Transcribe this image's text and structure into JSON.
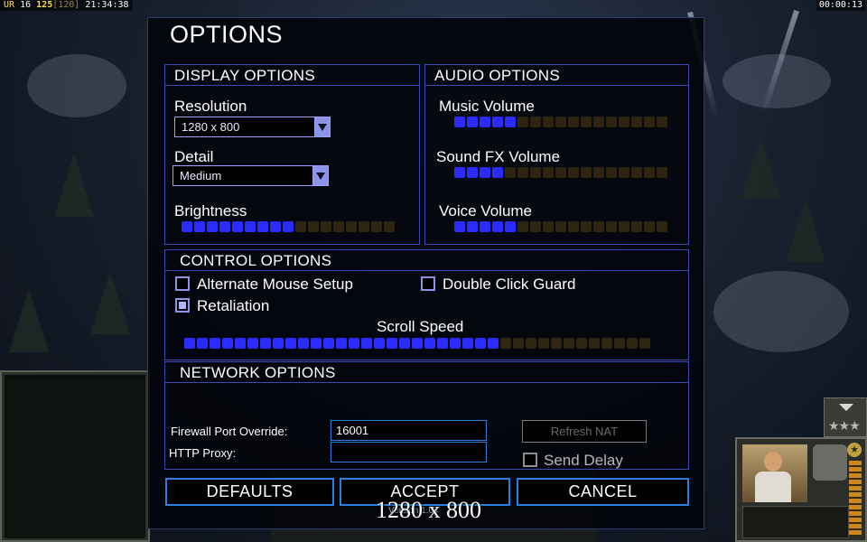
{
  "hud": {
    "rank_code": "UR",
    "level": "16",
    "money": "125",
    "money_cap": "[120]",
    "clock": "21:34:38",
    "timer": "00:00:13"
  },
  "dialog": {
    "title": "OPTIONS",
    "display": {
      "title": "DISPLAY OPTIONS",
      "resolution_label": "Resolution",
      "resolution_value": "1280 x 800",
      "detail_label": "Detail",
      "detail_value": "Medium",
      "brightness_label": "Brightness",
      "brightness_level": 0.5
    },
    "audio": {
      "title": "AUDIO OPTIONS",
      "music_label": "Music Volume",
      "music_level": 0.3,
      "sfx_label": "Sound FX Volume",
      "sfx_level": 0.25,
      "voice_label": "Voice Volume",
      "voice_level": 0.3
    },
    "control": {
      "title": "CONTROL OPTIONS",
      "alt_mouse_label": "Alternate Mouse Setup",
      "alt_mouse_checked": false,
      "double_click_label": "Double Click Guard",
      "double_click_checked": false,
      "retaliation_label": "Retaliation",
      "retaliation_checked": true,
      "scroll_label": "Scroll Speed",
      "scroll_level": 0.67
    },
    "network": {
      "title": "NETWORK OPTIONS",
      "firewall_label": "Firewall Port Override:",
      "firewall_value": "16001",
      "proxy_label": "HTTP Proxy:",
      "proxy_value": "",
      "refresh_nat_label": "Refresh NAT",
      "send_delay_label": "Send Delay",
      "send_delay_checked": false
    },
    "buttons": {
      "defaults": "DEFAULTS",
      "accept": "ACCEPT",
      "cancel": "CANCEL"
    }
  },
  "overlay": {
    "resolution_text": "1280 x 800",
    "under_text": "Version 1.04"
  },
  "colors": {
    "segment_on": "#2b2bff",
    "segment_off": "#2e2410",
    "panel_border": "#3a4ab8",
    "button_border": "#2a80e0"
  }
}
